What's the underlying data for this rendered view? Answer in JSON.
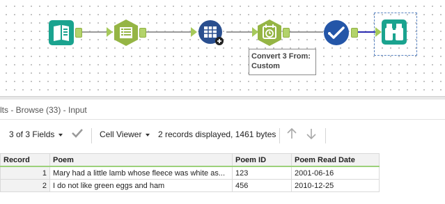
{
  "canvas": {
    "tools": [
      {
        "name": "input-data-tool",
        "icon": "book-icon",
        "color": "#1aa38f"
      },
      {
        "name": "select-tool",
        "icon": "table-list-icon",
        "color": "#95b545"
      },
      {
        "name": "multi-field-formula-tool",
        "icon": "grid-plus-icon",
        "color": "#2a4f8f"
      },
      {
        "name": "datetime-tool",
        "icon": "calendar-clock-icon",
        "color": "#95b545"
      },
      {
        "name": "dynamic-select-tool",
        "icon": "check-icon",
        "color": "#2456a8"
      },
      {
        "name": "browse-tool",
        "icon": "binoculars-icon",
        "color": "#1aa38f"
      }
    ],
    "annotation": "Convert 3 From: Custom"
  },
  "panel": {
    "title": "lts - Browse (33) - Input"
  },
  "toolbar": {
    "fields_label": "3 of 3 Fields",
    "viewer_label": "Cell Viewer",
    "records_info": "2 records displayed, 1461 bytes"
  },
  "table": {
    "columns": [
      "Record",
      "Poem",
      "Poem ID",
      "Poem Read Date"
    ],
    "rows": [
      [
        "1",
        "Mary had a little lamb whose fleece was white as...",
        "123",
        "2001-06-16"
      ],
      [
        "2",
        "I do not like green eggs and ham",
        "456",
        "2010-12-25"
      ]
    ]
  }
}
